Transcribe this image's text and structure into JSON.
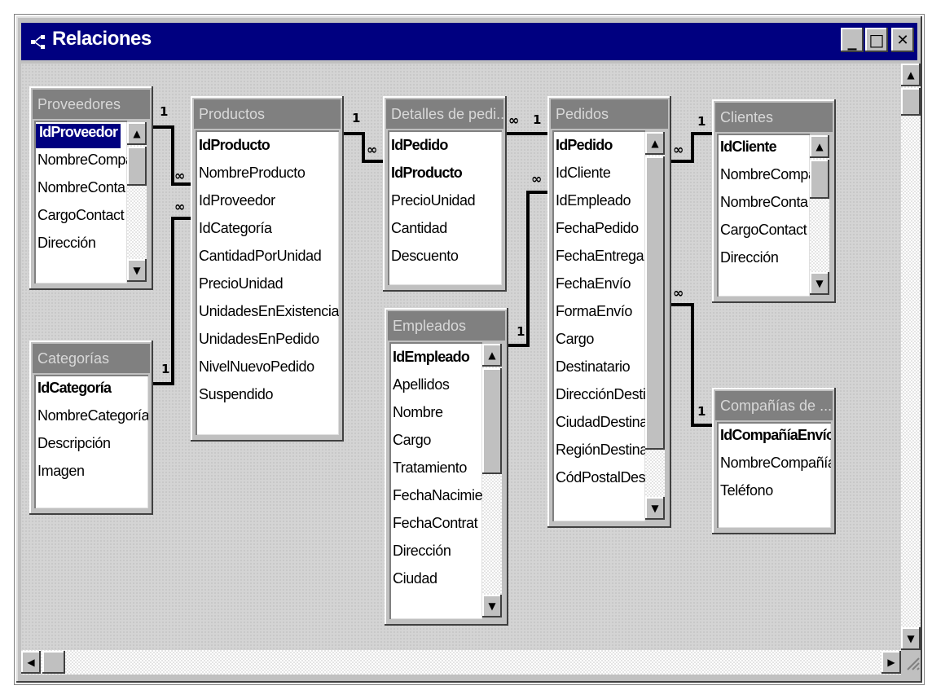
{
  "window": {
    "title": "Relaciones",
    "buttons": {
      "minimize": "_",
      "maximize": "□",
      "close": "✕"
    }
  },
  "scroll": {
    "up": "▲",
    "down": "▼",
    "left": "◀",
    "right": "▶"
  },
  "tables": {
    "proveedores": {
      "title": "Proveedores",
      "fields": [
        "IdProveedor",
        "NombreCompa",
        "NombreConta",
        "CargoContact",
        "Dirección"
      ]
    },
    "categorias": {
      "title": "Categorías",
      "fields": [
        "IdCategoría",
        "NombreCategoría",
        "Descripción",
        "Imagen"
      ]
    },
    "productos": {
      "title": "Productos",
      "fields": [
        "IdProducto",
        "NombreProducto",
        "IdProveedor",
        "IdCategoría",
        "CantidadPorUnidad",
        "PrecioUnidad",
        "UnidadesEnExistencia",
        "UnidadesEnPedido",
        "NivelNuevoPedido",
        "Suspendido"
      ]
    },
    "detalles": {
      "title": "Detalles de pedi...",
      "fields": [
        "IdPedido",
        "IdProducto",
        "PrecioUnidad",
        "Cantidad",
        "Descuento"
      ]
    },
    "empleados": {
      "title": "Empleados",
      "fields": [
        "IdEmpleado",
        "Apellidos",
        "Nombre",
        "Cargo",
        "Tratamiento",
        "FechaNacimiei",
        "FechaContrat",
        "Dirección",
        "Ciudad"
      ]
    },
    "pedidos": {
      "title": "Pedidos",
      "fields": [
        "IdPedido",
        "IdCliente",
        "IdEmpleado",
        "FechaPedido",
        "FechaEntrega",
        "FechaEnvío",
        "FormaEnvío",
        "Cargo",
        "Destinatario",
        "DirecciónDesti",
        "CiudadDestina",
        "RegiónDestina",
        "CódPostalDes"
      ]
    },
    "clientes": {
      "title": "Clientes",
      "fields": [
        "IdCliente",
        "NombreCompa",
        "NombreConta",
        "CargoContact",
        "Dirección"
      ]
    },
    "companias": {
      "title": "Compañías de ...",
      "fields": [
        "IdCompañíaEnvío",
        "NombreCompañía",
        "Teléfono"
      ]
    }
  },
  "relations": {
    "one": "1",
    "many": "∞"
  }
}
